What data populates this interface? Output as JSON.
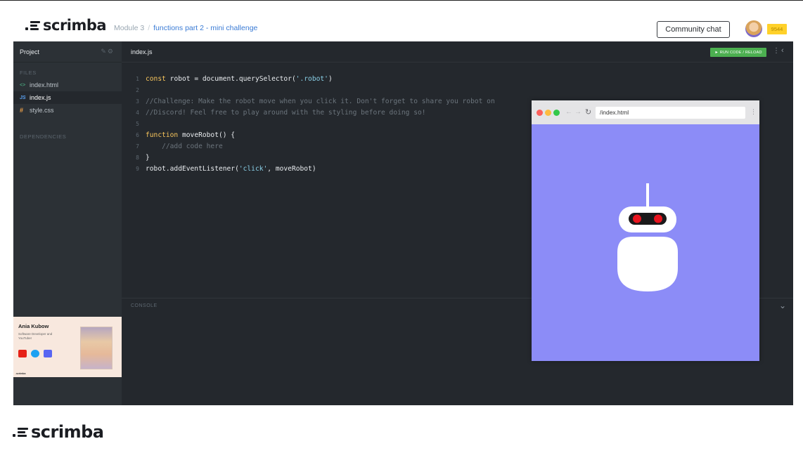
{
  "header": {
    "logo_text": "scrimba",
    "breadcrumb_module": "Module 3",
    "breadcrumb_separator": "/",
    "breadcrumb_title": "functions part 2 - mini challenge",
    "community_button": "Community chat",
    "points": "9544"
  },
  "sidebar": {
    "title": "Project",
    "files_label": "FILES",
    "files": [
      {
        "icon": "<>",
        "name": "index.html"
      },
      {
        "icon": "JS",
        "name": "index.js"
      },
      {
        "icon": "#",
        "name": "style.css"
      }
    ],
    "dependencies_label": "DEPENDENCIES"
  },
  "teacher": {
    "name": "Ania Kubow",
    "role": "Software Developer and YouTuber",
    "brand": ".scrimba"
  },
  "editor": {
    "tab": "index.js",
    "run_button": "► RUN CODE / RELOAD",
    "lines": [
      {
        "n": "1",
        "parts": [
          {
            "t": "const",
            "c": "kw"
          },
          {
            "t": " robot = document.querySelector(",
            "c": ""
          },
          {
            "t": "'.robot'",
            "c": "str"
          },
          {
            "t": ")",
            "c": ""
          }
        ]
      },
      {
        "n": "2",
        "parts": []
      },
      {
        "n": "3",
        "parts": [
          {
            "t": "//Challenge: Make the robot move when you click it. Don't forget to share you robot on",
            "c": "cm"
          }
        ]
      },
      {
        "n": "4",
        "parts": [
          {
            "t": "//Discord! Feel free to play around with the styling before doing so!",
            "c": "cm"
          }
        ]
      },
      {
        "n": "5",
        "parts": []
      },
      {
        "n": "6",
        "parts": [
          {
            "t": "function",
            "c": "kw"
          },
          {
            "t": " moveRobot() {",
            "c": ""
          }
        ]
      },
      {
        "n": "7",
        "parts": [
          {
            "t": "    //add code here",
            "c": "cm"
          }
        ]
      },
      {
        "n": "8",
        "parts": [
          {
            "t": "}",
            "c": ""
          }
        ]
      },
      {
        "n": "9",
        "parts": [
          {
            "t": "robot.addEventListener(",
            "c": ""
          },
          {
            "t": "'click'",
            "c": "str"
          },
          {
            "t": ", moveRobot)",
            "c": ""
          }
        ]
      }
    ]
  },
  "console": {
    "label": "CONSOLE"
  },
  "preview": {
    "url": "/index.html",
    "background_color": "#8c8cf7",
    "robot_eye_color": "#e8141e"
  },
  "footer": {
    "logo_text": "scrimba"
  }
}
